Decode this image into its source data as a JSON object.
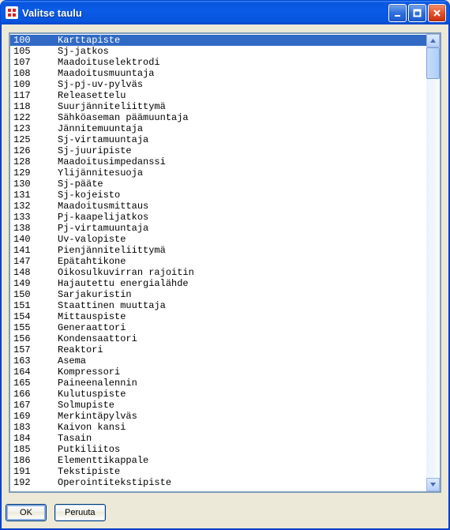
{
  "window": {
    "title": "Valitse taulu"
  },
  "buttons": {
    "ok": "OK",
    "cancel": "Peruuta"
  },
  "list": {
    "selected_index": 0,
    "items": [
      {
        "code": "100",
        "name": "Karttapiste"
      },
      {
        "code": "105",
        "name": "Sj-jatkos"
      },
      {
        "code": "107",
        "name": "Maadoituselektrodi"
      },
      {
        "code": "108",
        "name": "Maadoitusmuuntaja"
      },
      {
        "code": "109",
        "name": "Sj-pj-uv-pylväs"
      },
      {
        "code": "117",
        "name": "Releasettelu"
      },
      {
        "code": "118",
        "name": "Suurjänniteliittymä"
      },
      {
        "code": "122",
        "name": "Sähköaseman päämuuntaja"
      },
      {
        "code": "123",
        "name": "Jännitemuuntaja"
      },
      {
        "code": "125",
        "name": "Sj-virtamuuntaja"
      },
      {
        "code": "126",
        "name": "Sj-juuripiste"
      },
      {
        "code": "128",
        "name": "Maadoitusimpedanssi"
      },
      {
        "code": "129",
        "name": "Ylijännitesuoja"
      },
      {
        "code": "130",
        "name": "Sj-pääte"
      },
      {
        "code": "131",
        "name": "Sj-kojeisto"
      },
      {
        "code": "132",
        "name": "Maadoitusmittaus"
      },
      {
        "code": "133",
        "name": "Pj-kaapelijatkos"
      },
      {
        "code": "138",
        "name": "Pj-virtamuuntaja"
      },
      {
        "code": "140",
        "name": "Uv-valopiste"
      },
      {
        "code": "141",
        "name": "Pienjänniteliittymä"
      },
      {
        "code": "147",
        "name": "Epätahtikone"
      },
      {
        "code": "148",
        "name": "Oikosulkuvirran rajoitin"
      },
      {
        "code": "149",
        "name": "Hajautettu energialähde"
      },
      {
        "code": "150",
        "name": "Sarjakuristin"
      },
      {
        "code": "151",
        "name": "Staattinen muuttaja"
      },
      {
        "code": "154",
        "name": "Mittauspiste"
      },
      {
        "code": "155",
        "name": "Generaattori"
      },
      {
        "code": "156",
        "name": "Kondensaattori"
      },
      {
        "code": "157",
        "name": "Reaktori"
      },
      {
        "code": "163",
        "name": "Asema"
      },
      {
        "code": "164",
        "name": "Kompressori"
      },
      {
        "code": "165",
        "name": "Paineenalennin"
      },
      {
        "code": "166",
        "name": "Kulutuspiste"
      },
      {
        "code": "167",
        "name": "Solmupiste"
      },
      {
        "code": "169",
        "name": "Merkintäpylväs"
      },
      {
        "code": "183",
        "name": "Kaivon kansi"
      },
      {
        "code": "184",
        "name": "Tasain"
      },
      {
        "code": "185",
        "name": "Putkiliitos"
      },
      {
        "code": "186",
        "name": "Elementtikappale"
      },
      {
        "code": "191",
        "name": "Tekstipiste"
      },
      {
        "code": "192",
        "name": "Operointitekstipiste"
      }
    ]
  }
}
